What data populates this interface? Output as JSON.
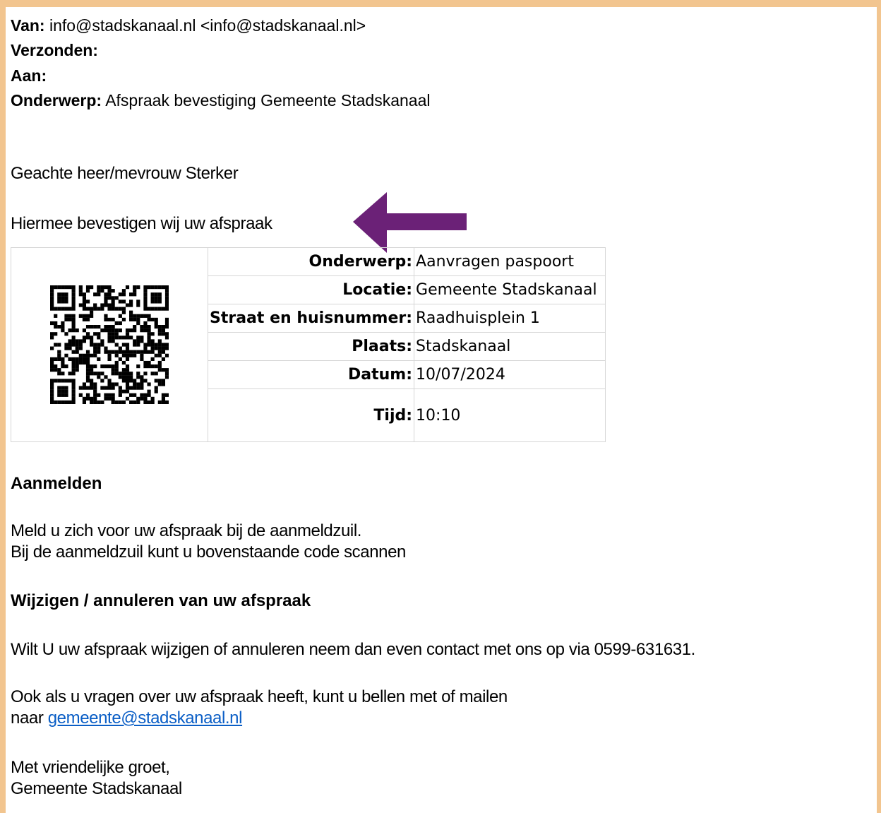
{
  "email": {
    "from_label": "Van:",
    "from_value": "info@stadskanaal.nl <info@stadskanaal.nl>",
    "sent_label": "Verzonden:",
    "to_label": "Aan:",
    "subject_label": "Onderwerp:",
    "subject_value": "Afspraak bevestiging Gemeente Stadskanaal"
  },
  "body": {
    "greeting": "Geachte heer/mevrouw Sterker",
    "confirm_text": "Hiermee bevestigen wij uw afspraak"
  },
  "appointment": {
    "rows": [
      {
        "label": "Onderwerp:",
        "value": "Aanvragen paspoort"
      },
      {
        "label": "Locatie:",
        "value": "Gemeente Stadskanaal"
      },
      {
        "label": "Straat en huisnummer:",
        "value": "Raadhuisplein 1"
      },
      {
        "label": "Plaats:",
        "value": "Stadskanaal"
      },
      {
        "label": "Datum:",
        "value": "10/07/2024"
      },
      {
        "label": "Tijd:",
        "value": "10:10"
      }
    ]
  },
  "checkin": {
    "heading": "Aanmelden",
    "line1": "Meld u zich voor uw afspraak bij de aanmeldzuil.",
    "line2": "Bij de aanmeldzuil kunt u bovenstaande code scannen"
  },
  "change": {
    "heading": "Wijzigen / annuleren van uw afspraak",
    "text": "Wilt U uw afspraak wijzigen of annuleren neem dan even contact met ons op via 0599-631631.",
    "questions_line1": "Ook als u vragen over uw afspraak heeft, kunt u bellen met of mailen",
    "questions_prefix": "naar",
    "email_link": "gemeente@stadskanaal.nl"
  },
  "closing": {
    "line1": "Met vriendelijke groet,",
    "line2": "Gemeente Stadskanaal"
  },
  "colors": {
    "frame": "#f2c58f",
    "arrow": "#6b2177",
    "link": "#0a5ec6"
  },
  "icons": {
    "qr": "qr-code-icon",
    "arrow": "arrow-left-icon"
  }
}
